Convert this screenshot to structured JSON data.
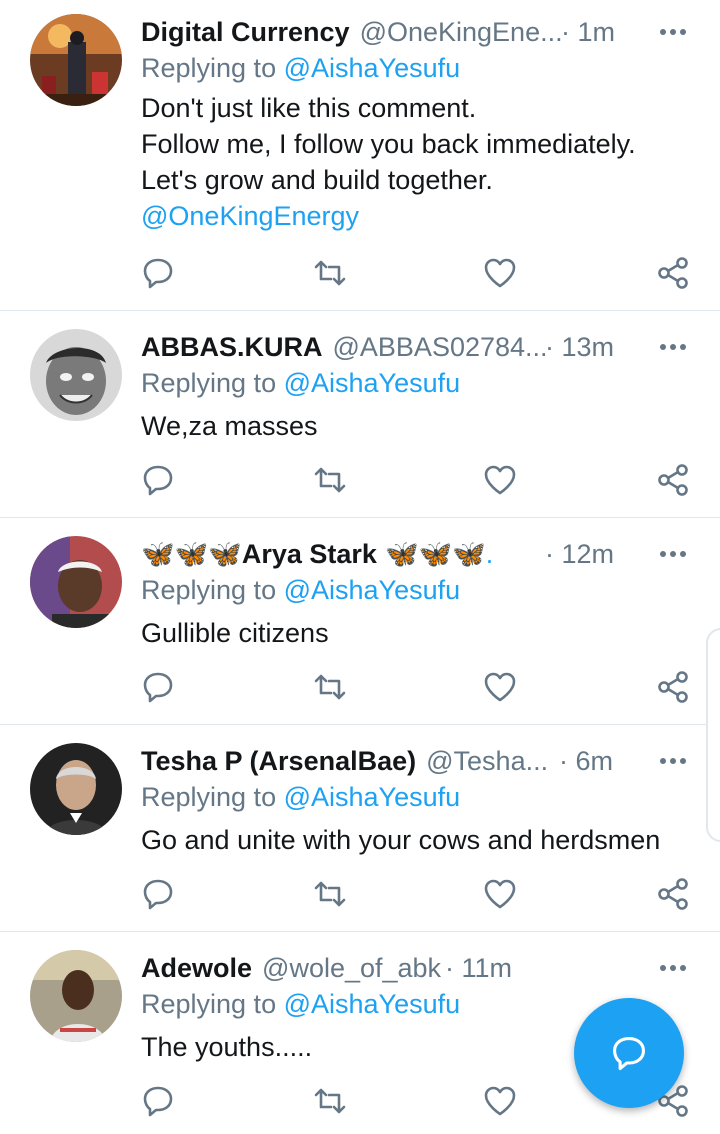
{
  "tweets": [
    {
      "name": "Digital Currency",
      "handle": "@OneKingEne...",
      "time": "· 1m",
      "replying_prefix": "Replying to ",
      "replying_to": "@AishaYesufu",
      "lines": [
        "Don't just like this comment.",
        "Follow me, I follow you back immediately.",
        "Let's grow and build together."
      ],
      "mention": "@OneKingEnergy"
    },
    {
      "name": "ABBAS.KURA",
      "handle": "@ABBAS02784...",
      "time": "· 13m",
      "replying_prefix": "Replying to ",
      "replying_to": "@AishaYesufu",
      "lines": [
        "We,za masses"
      ]
    },
    {
      "name_prefix": "🦋🦋🦋",
      "name": "Arya Stark",
      "name_suffix": "🦋🦋🦋.",
      "time": "· 12m",
      "replying_prefix": "Replying to ",
      "replying_to": "@AishaYesufu",
      "lines": [
        "Gullible citizens"
      ]
    },
    {
      "name": "Tesha P (ArsenalBae)",
      "handle": "@Tesha...",
      "time": "· 6m",
      "replying_prefix": "Replying to ",
      "replying_to": "@AishaYesufu",
      "lines": [
        "Go and unite with your cows and herdsmen"
      ]
    },
    {
      "name": "Adewole",
      "handle": "@wole_of_abk",
      "time": "· 11m",
      "replying_prefix": "Replying to ",
      "replying_to": "@AishaYesufu",
      "lines": [
        "The youths....."
      ]
    }
  ],
  "icons": {
    "reply": "reply-icon",
    "retweet": "retweet-icon",
    "like": "heart-icon",
    "share": "share-icon",
    "more": "more-icon",
    "compose": "compose-reply-icon"
  },
  "colors": {
    "accent": "#1da1f2",
    "secondary_text": "#657786",
    "primary_text": "#14171a",
    "divider": "#e1e8ed"
  }
}
